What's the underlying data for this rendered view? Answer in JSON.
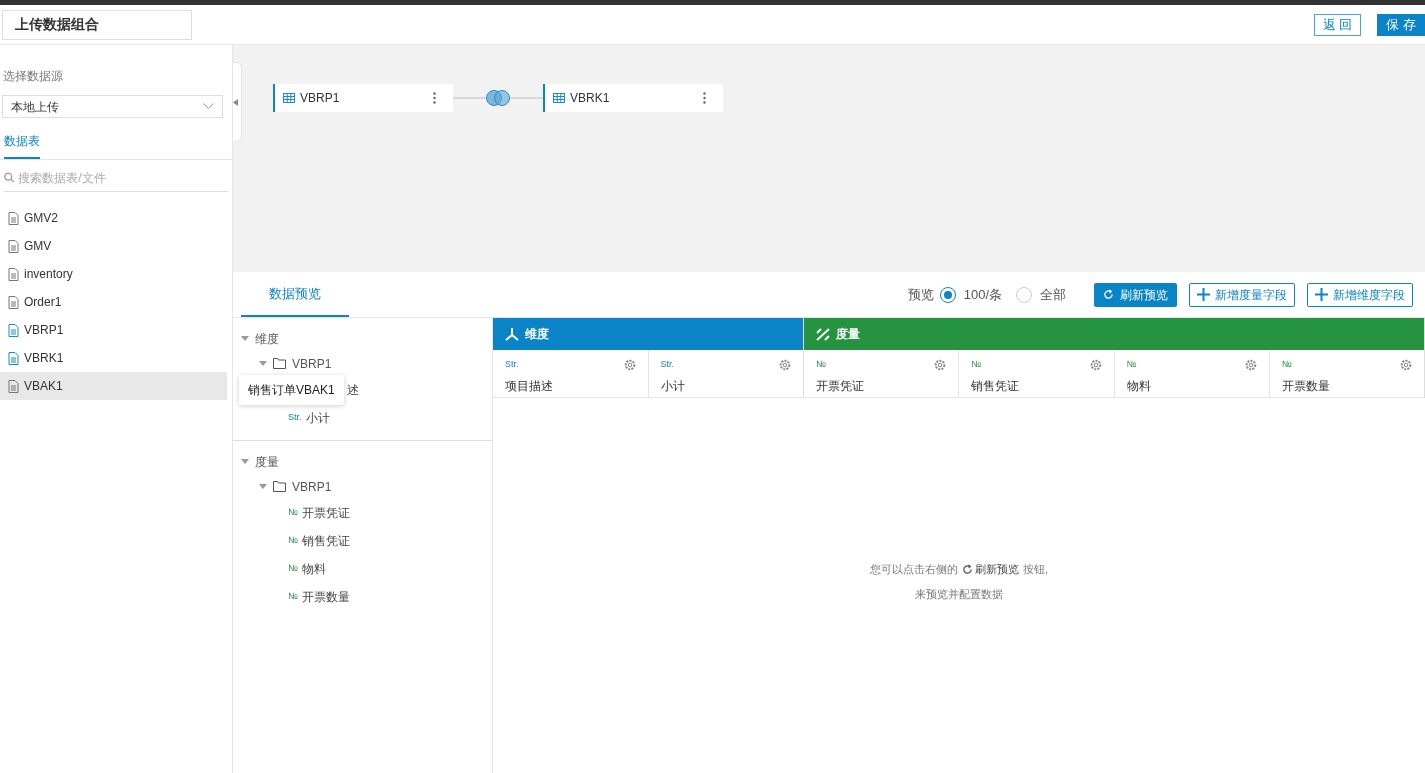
{
  "header": {
    "title": "上传数据组合",
    "buttons": [
      {
        "label": "返 回",
        "kind": "outline"
      },
      {
        "label": "保 存",
        "kind": "primary"
      }
    ]
  },
  "sidebar": {
    "source_label": "选择数据源",
    "source_value": "本地上传",
    "tabs": [
      {
        "label": "数据表",
        "selected": true
      }
    ],
    "search_placeholder": "搜索数据表/文件",
    "items": [
      {
        "label": "GMV2",
        "in_use": false,
        "hovered": false
      },
      {
        "label": "GMV",
        "in_use": false,
        "hovered": false
      },
      {
        "label": "inventory",
        "in_use": false,
        "hovered": false
      },
      {
        "label": "Order1",
        "in_use": false,
        "hovered": false
      },
      {
        "label": "VBRP1",
        "in_use": true,
        "hovered": false
      },
      {
        "label": "VBRK1",
        "in_use": true,
        "hovered": false
      },
      {
        "label": "VBAK1",
        "in_use": false,
        "hovered": true
      }
    ]
  },
  "canvas": {
    "nodes": [
      {
        "label": "VBRP1"
      },
      {
        "label": "VBRK1"
      }
    ]
  },
  "preview": {
    "tabs": [
      {
        "label": "数据预览",
        "selected": true
      }
    ],
    "preview_label": "预览",
    "radios": [
      {
        "label": "100/条",
        "selected": true
      },
      {
        "label": "全部",
        "selected": false
      }
    ],
    "buttons": [
      {
        "label": "刷新预览",
        "kind": "refresh"
      },
      {
        "label": "新增度量字段",
        "kind": "add"
      },
      {
        "label": "新增维度字段",
        "kind": "add"
      }
    ],
    "tree": [
      {
        "label": "维度",
        "expanded": true,
        "children": [
          {
            "label": "VBRP1",
            "expanded": true,
            "children": [
              {
                "label": "述"
              },
              {
                "tag": "Str.",
                "kind": "dim",
                "label": "小计"
              }
            ]
          }
        ]
      },
      {
        "label": "度量",
        "expanded": true,
        "children": [
          {
            "label": "VBRP1",
            "expanded": true,
            "children": [
              {
                "tag": "№",
                "kind": "measure",
                "label": "开票凭证"
              },
              {
                "tag": "№",
                "kind": "measure",
                "label": "销售凭证"
              },
              {
                "tag": "№",
                "kind": "measure",
                "label": "物料"
              },
              {
                "tag": "№",
                "kind": "measure",
                "label": "开票数量"
              }
            ]
          }
        ]
      }
    ],
    "tooltip": "销售订单VBAK1",
    "groups": [
      {
        "label": "维度",
        "kind": "dim",
        "columns": [
          {
            "tag": "Str.",
            "label": "项目描述"
          },
          {
            "tag": "Str.",
            "label": "小计"
          }
        ]
      },
      {
        "label": "度量",
        "kind": "measure",
        "columns": [
          {
            "tag": "№",
            "label": "开票凭证"
          },
          {
            "tag": "№",
            "label": "销售凭证"
          },
          {
            "tag": "№",
            "label": "物料"
          },
          {
            "tag": "№",
            "label": "开票数量"
          }
        ]
      }
    ],
    "empty": {
      "line1_before": "您可以点击右侧的",
      "line1_button": "刷新预览",
      "line1_after": "按钮,",
      "line2": "来预览并配置数据"
    }
  }
}
